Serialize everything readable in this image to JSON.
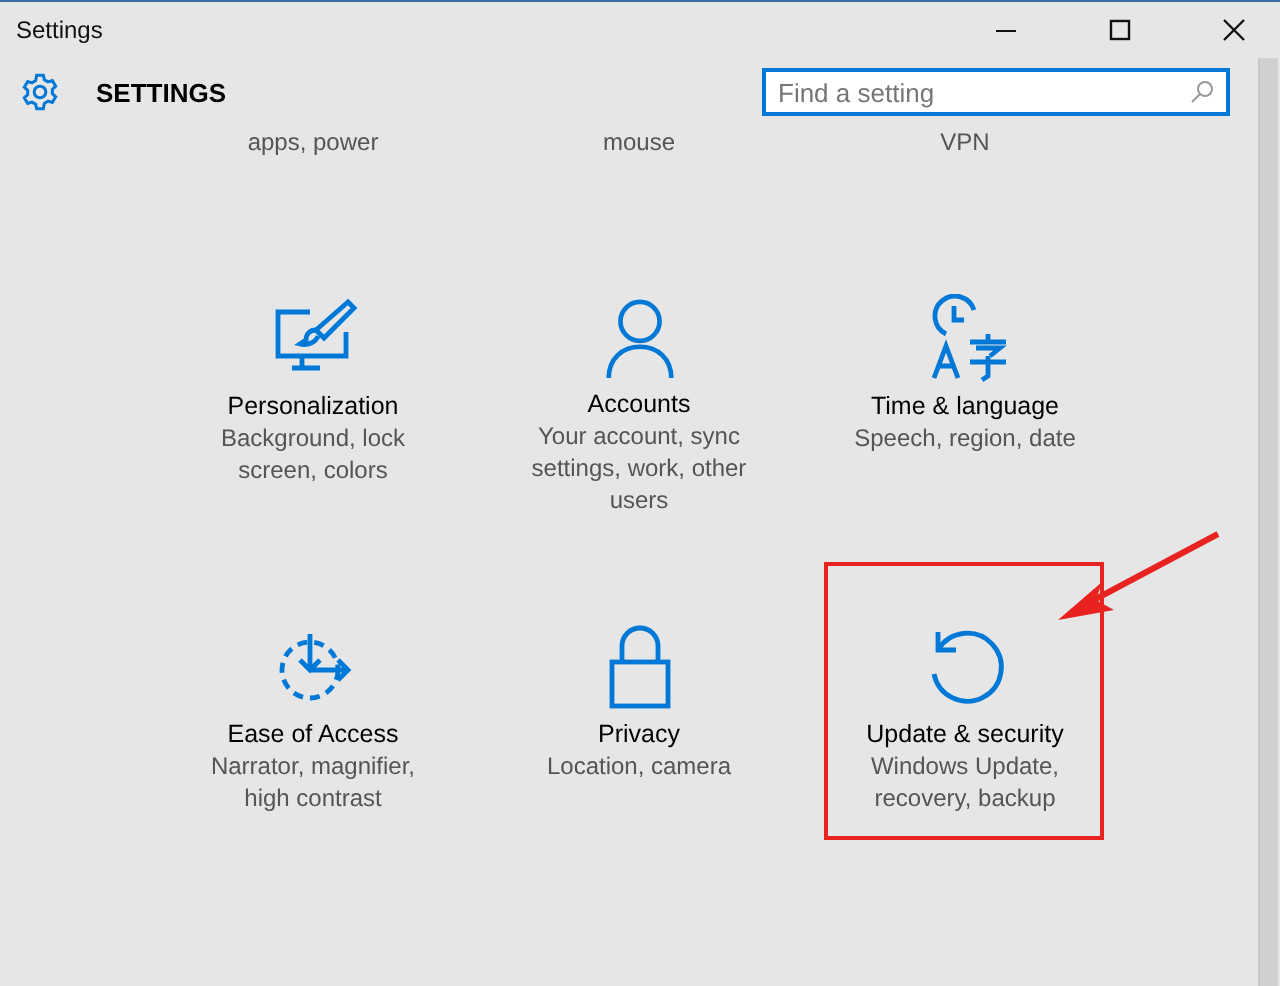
{
  "window": {
    "title": "Settings"
  },
  "header": {
    "title": "SETTINGS",
    "search": {
      "placeholder": "Find a setting"
    }
  },
  "partial_row": [
    "apps, power",
    "mouse",
    "VPN"
  ],
  "tiles": [
    {
      "kind": "personalization",
      "title": "Personalization",
      "description": "Background, lock screen, colors",
      "highlighted": false
    },
    {
      "kind": "accounts",
      "title": "Accounts",
      "description": "Your account, sync settings, work, other users",
      "highlighted": false
    },
    {
      "kind": "time",
      "title": "Time & language",
      "description": "Speech, region, date",
      "highlighted": false
    },
    {
      "kind": "ease",
      "title": "Ease of Access",
      "description": "Narrator, magnifier, high contrast",
      "highlighted": false
    },
    {
      "kind": "privacy",
      "title": "Privacy",
      "description": "Location, camera",
      "highlighted": false
    },
    {
      "kind": "update",
      "title": "Update & security",
      "description": "Windows Update, recovery, backup",
      "highlighted": true
    }
  ]
}
